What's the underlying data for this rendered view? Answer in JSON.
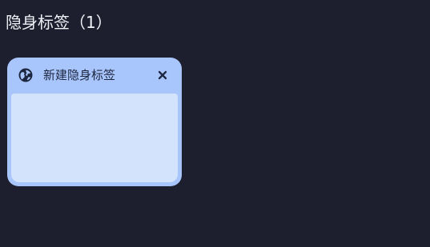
{
  "section": {
    "title": "隐身标签（1）"
  },
  "tabs": [
    {
      "title": "新建隐身标签",
      "icon": "globe-icon",
      "close_icon": "close-icon"
    }
  ],
  "colors": {
    "background": "#1d1f2e",
    "card": "#a8c5fc",
    "preview": "#d3e3fc",
    "card_text": "#1e2740",
    "title_text": "#f1f2f8"
  }
}
